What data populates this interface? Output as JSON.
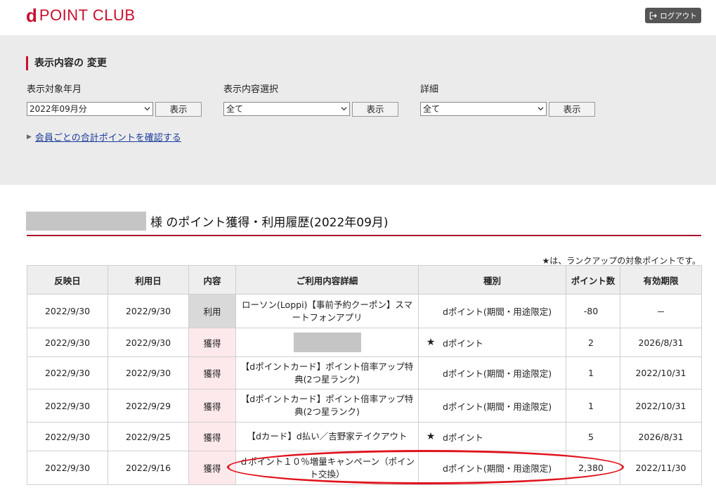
{
  "header": {
    "logo_d": "d",
    "logo_text": "POINT CLUB",
    "logout_label": "ログアウト"
  },
  "filter": {
    "title": "表示内容の 変更",
    "year_month_label": "表示対象年月",
    "year_month_value": "2022年09月分",
    "content_label": "表示内容選択",
    "content_value": "全て",
    "detail_label": "詳細",
    "detail_value": "全て",
    "show_button": "表示",
    "member_link": "会員ごとの合計ポイントを確認する"
  },
  "history": {
    "title": "様 のポイント獲得・利用履歴(2022年09月)",
    "note": "★は、ランクアップの対象ポイントです。",
    "columns": [
      "反映日",
      "利用日",
      "内容",
      "ご利用内容詳細",
      "種別",
      "ポイント数",
      "有効期限"
    ],
    "rows": [
      {
        "posted": "2022/9/30",
        "used": "2022/9/30",
        "kind": "利用",
        "detail": "ローソン(Loppi)【事前予約クーポン】スマートフォンアプリ",
        "star": "",
        "type": "dポイント(期間・用途限定)",
        "points": "-80",
        "expiry": "－"
      },
      {
        "posted": "2022/9/30",
        "used": "2022/9/30",
        "kind": "獲得",
        "detail": "",
        "star": "★",
        "type": "dポイント",
        "points": "2",
        "expiry": "2026/8/31"
      },
      {
        "posted": "2022/9/30",
        "used": "2022/9/30",
        "kind": "獲得",
        "detail": "【dポイントカード】ポイント倍率アップ特典(2つ星ランク)",
        "star": "",
        "type": "dポイント(期間・用途限定)",
        "points": "1",
        "expiry": "2022/10/31"
      },
      {
        "posted": "2022/9/30",
        "used": "2022/9/29",
        "kind": "獲得",
        "detail": "【dポイントカード】ポイント倍率アップ特典(2つ星ランク)",
        "star": "",
        "type": "dポイント(期間・用途限定)",
        "points": "1",
        "expiry": "2022/10/31"
      },
      {
        "posted": "2022/9/30",
        "used": "2022/9/25",
        "kind": "獲得",
        "detail": "【dカード】d払い／吉野家テイクアウト",
        "star": "★",
        "type": "dポイント",
        "points": "5",
        "expiry": "2026/8/31"
      },
      {
        "posted": "2022/9/30",
        "used": "2022/9/16",
        "kind": "獲得",
        "detail": "ｄポイント１０％増量キャンペーン（ポイント交換）",
        "star": "",
        "type": "dポイント(期間・用途限定)",
        "points": "2,380",
        "expiry": "2022/11/30"
      }
    ]
  },
  "colors": {
    "brand": "#c8102e",
    "highlight": "#e0141e",
    "earn_bg": "#fde9ec",
    "use_bg": "#d9d9d9"
  }
}
